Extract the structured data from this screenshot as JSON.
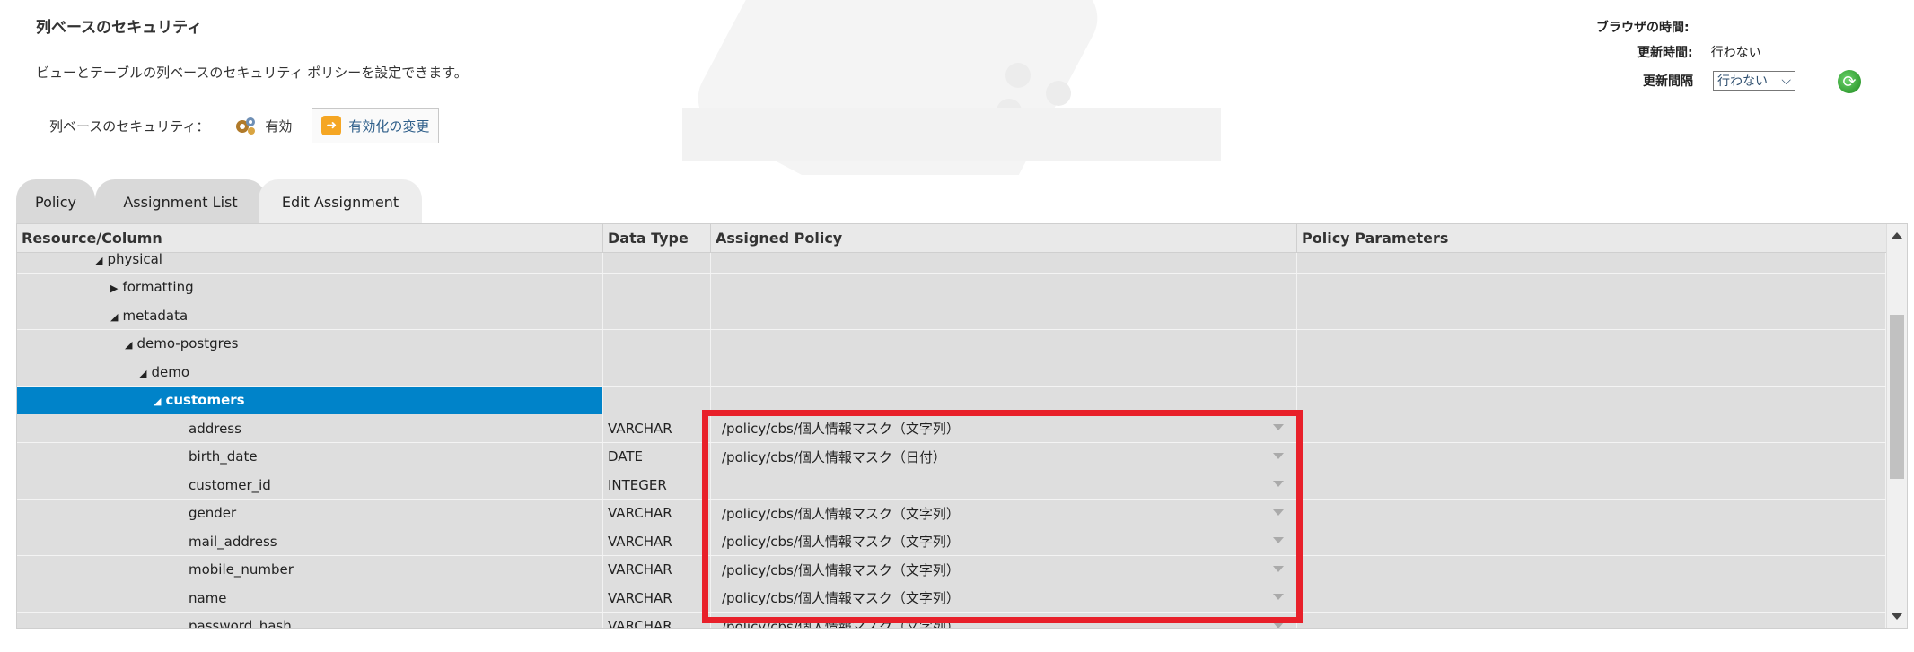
{
  "header": {
    "title": "列ベースのセキュリティ",
    "description": "ビューとテーブルの列ベースのセキュリティ ポリシーを設定できます。",
    "security_label": "列ベースのセキュリティ：",
    "security_status": "有効",
    "change_button": "有効化の変更"
  },
  "time_panel": {
    "browser_time_label": "ブラウザの時間:",
    "browser_time_value": "",
    "update_time_label": "更新時間:",
    "update_time_value": "行わない",
    "interval_label": "更新間隔",
    "interval_value": "行わない"
  },
  "tabs": [
    {
      "label": "Policy",
      "active": false
    },
    {
      "label": "Assignment List",
      "active": false
    },
    {
      "label": "Edit Assignment",
      "active": true
    }
  ],
  "grid": {
    "columns": [
      "Resource/Column",
      "Data Type",
      "Assigned Policy",
      "Policy Parameters"
    ],
    "rows": [
      {
        "name": "physical",
        "expander": "◢",
        "type": "",
        "policy": "",
        "params": ""
      },
      {
        "name": "formatting",
        "expander": "▶",
        "type": "",
        "policy": "",
        "params": ""
      },
      {
        "name": "metadata",
        "expander": "◢",
        "type": "",
        "policy": "",
        "params": ""
      },
      {
        "name": "demo-postgres",
        "expander": "◢",
        "type": "",
        "policy": "",
        "params": ""
      },
      {
        "name": "demo",
        "expander": "◢",
        "type": "",
        "policy": "",
        "params": ""
      },
      {
        "name": "customers",
        "expander": "◢",
        "type": "",
        "policy": "",
        "params": "",
        "selected": true
      },
      {
        "name": "address",
        "expander": "",
        "type": "VARCHAR",
        "policy": "/policy/cbs/個人情報マスク（文字列）",
        "params": ""
      },
      {
        "name": "birth_date",
        "expander": "",
        "type": "DATE",
        "policy": "/policy/cbs/個人情報マスク（日付）",
        "params": ""
      },
      {
        "name": "customer_id",
        "expander": "",
        "type": "INTEGER",
        "policy": "",
        "params": ""
      },
      {
        "name": "gender",
        "expander": "",
        "type": "VARCHAR",
        "policy": "/policy/cbs/個人情報マスク（文字列）",
        "params": ""
      },
      {
        "name": "mail_address",
        "expander": "",
        "type": "VARCHAR",
        "policy": "/policy/cbs/個人情報マスク（文字列）",
        "params": ""
      },
      {
        "name": "mobile_number",
        "expander": "",
        "type": "VARCHAR",
        "policy": "/policy/cbs/個人情報マスク（文字列）",
        "params": ""
      },
      {
        "name": "name",
        "expander": "",
        "type": "VARCHAR",
        "policy": "/policy/cbs/個人情報マスク（文字列）",
        "params": ""
      },
      {
        "name": "password_hash",
        "expander": "",
        "type": "VARCHAR",
        "policy": "/policy/cbs/個人情報マスク（文字列）",
        "params": ""
      }
    ]
  },
  "colors": {
    "selected_row": "#0083c9",
    "highlight_border": "#e8202a",
    "accent_icon": "#f5a623"
  },
  "icons": {
    "status": "gears-icon",
    "change": "arrow-right-icon",
    "refresh": "refresh-icon"
  }
}
